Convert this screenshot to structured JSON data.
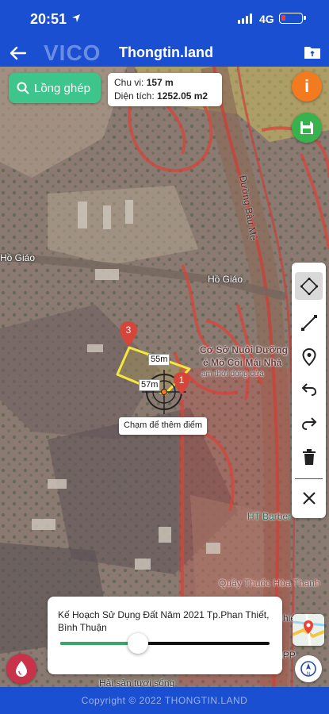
{
  "status_bar": {
    "time": "20:51",
    "network": "4G"
  },
  "header": {
    "logo": "VICO",
    "title": "Thongtin.land"
  },
  "search": {
    "label": "Lồng ghép"
  },
  "measure": {
    "perimeter_label": "Chu vi:",
    "perimeter_value": "157 m",
    "area_label": "Diện tích:",
    "area_value": "1252.05 m2"
  },
  "info_button": {
    "glyph": "i"
  },
  "map": {
    "place_labels": {
      "ho_giao_left": "Hồ Giáo",
      "ho_giao_right": "Hồ Giáo",
      "road": "Đường Bàu Mê",
      "poi_line1": "Cơ Sở Nuôi Dưỡng",
      "poi_line2": "ẻ Mồ Côi Mái Nhà",
      "poi_status": "ạm thời đóng cửa",
      "barber": "HT Barber",
      "pharmacy": "Quầy Thuốc Hòa Thanh",
      "seafood": "Hải sản tươi sống",
      "gpp": "Hằng Nga GPP",
      "thien": "hiê"
    },
    "markers": {
      "point_3": "3",
      "point_1": "1"
    },
    "distances": {
      "top_edge": "55m",
      "left_edge": "57m"
    },
    "tap_hint": "Chạm để thêm điểm"
  },
  "toolbar": {
    "tools": [
      "select-tool",
      "measure-line",
      "add-point",
      "undo",
      "redo",
      "delete",
      "close"
    ]
  },
  "layer": {
    "title": "Kế Hoạch Sử Dụng Đất Năm 2021 Tp.Phan Thiết, Bình Thuận",
    "opacity_percent": 37
  },
  "footer": {
    "copyright": "Copyright © 2022 THONGTIN.LAND"
  },
  "colors": {
    "brand": "#1b4fd1",
    "search_green": "#3ec58b",
    "info_orange": "#f47a1f",
    "save_green": "#37b24d",
    "plan_boundary": "#d6453a",
    "measure_yellow": "#f5e83a",
    "slider_fill": "#3aa46a"
  }
}
